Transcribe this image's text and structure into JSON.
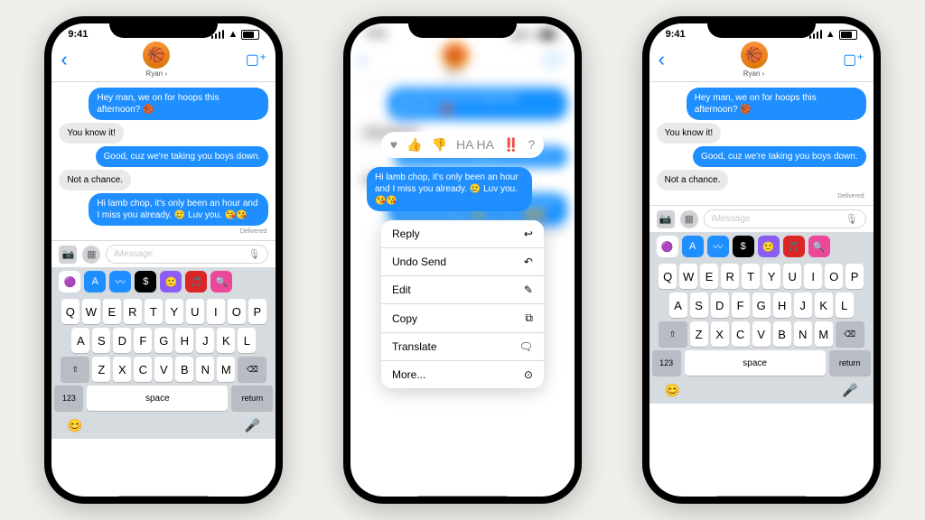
{
  "status": {
    "time": "9:41"
  },
  "contact": {
    "name": "Ryan",
    "emoji": "🏀"
  },
  "chat": [
    {
      "kind": "out",
      "text": "Hey man, we on for hoops this afternoon? 🏀"
    },
    {
      "kind": "in",
      "text": "You know it!"
    },
    {
      "kind": "out",
      "text": "Good, cuz we're taking you boys down."
    },
    {
      "kind": "in",
      "text": "Not a chance."
    },
    {
      "kind": "out",
      "text": "Hi lamb chop, it's only been an hour and I miss you already. 🥲 Luv you. 😘😘"
    }
  ],
  "delivered": "Delivered",
  "compose": {
    "placeholder": "iMessage"
  },
  "keyboard": {
    "rows": [
      [
        "Q",
        "W",
        "E",
        "R",
        "T",
        "Y",
        "U",
        "I",
        "O",
        "P"
      ],
      [
        "A",
        "S",
        "D",
        "F",
        "G",
        "H",
        "J",
        "K",
        "L"
      ],
      [
        "Z",
        "X",
        "C",
        "V",
        "B",
        "N",
        "M"
      ]
    ],
    "shift": "⇧",
    "del": "⌫",
    "num": "123",
    "space": "space",
    "ret": "return",
    "emoji": "😊",
    "mic": "🎤"
  },
  "tapbacks": [
    "♥",
    "👍",
    "👎",
    "HA HA",
    "‼️",
    "?"
  ],
  "menu": [
    {
      "label": "Reply",
      "icon": "↩"
    },
    {
      "label": "Undo Send",
      "icon": "↶"
    },
    {
      "label": "Edit",
      "icon": "✎"
    },
    {
      "label": "Copy",
      "icon": "⧉"
    },
    {
      "label": "Translate",
      "icon": "🗨"
    },
    {
      "label": "More...",
      "icon": "⊙"
    }
  ],
  "apps": [
    {
      "bg": "#fff",
      "char": "🟣"
    },
    {
      "bg": "#1f8fff",
      "char": "A"
    },
    {
      "bg": "#1f8fff",
      "char": "〰"
    },
    {
      "bg": "#000",
      "char": "$"
    },
    {
      "bg": "#8b5cf6",
      "char": "🙂"
    },
    {
      "bg": "#dc2626",
      "char": "🎵"
    },
    {
      "bg": "#ec4899",
      "char": "🔍"
    }
  ]
}
